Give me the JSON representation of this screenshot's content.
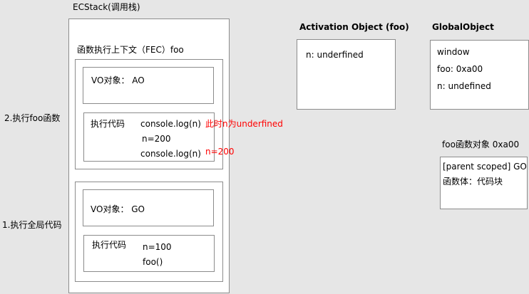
{
  "ecstack": {
    "title": "ECStack(调用栈)",
    "fec": {
      "title": "函数执行上下文（FEC）foo",
      "vo": "VO对象：  AO",
      "exec_label": "执行代码",
      "code": [
        "console.log(n)",
        "n=200",
        "console.log(n)"
      ],
      "notes": [
        "此时n为underfined",
        "n=200"
      ]
    },
    "gec": {
      "vo": "VO对象：  GO",
      "exec_label": "执行代码",
      "code": [
        "n=100",
        "foo()"
      ]
    }
  },
  "steps": {
    "step2": "2.执行foo函数",
    "step1": "1.执行全局代码"
  },
  "activation_object": {
    "title": "Activation Object (foo)",
    "entries": [
      "n: underfined"
    ]
  },
  "global_object": {
    "title": "GlobalObject",
    "entries": [
      "window",
      "foo: 0xa00",
      "n: undefined"
    ]
  },
  "foo_function_object": {
    "title": "foo函数对象 0xa00",
    "entries": [
      "[parent scoped]   GO",
      "函数体：代码块"
    ]
  }
}
